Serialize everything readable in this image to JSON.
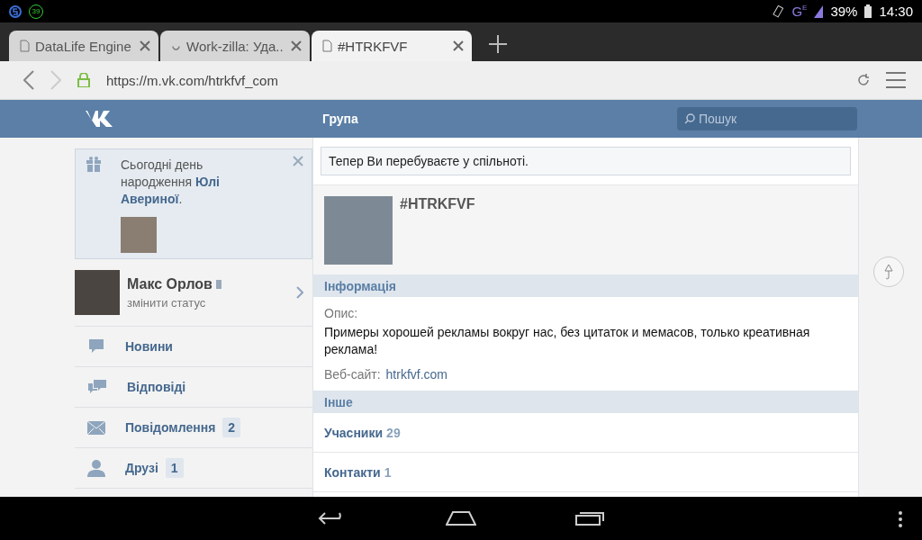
{
  "status_bar": {
    "notification_count": "39",
    "network": "G",
    "network_sub": "E",
    "battery": "39%",
    "time": "14:30"
  },
  "tabs": [
    {
      "title": "DataLife Engine",
      "selected": false,
      "loading": false
    },
    {
      "title": "Work-zilla: Уда...",
      "selected": false,
      "loading": true
    },
    {
      "title": "#HTRKFVF",
      "selected": true,
      "loading": false
    }
  ],
  "address_bar": {
    "url": "https://m.vk.com/htrkfvf_com",
    "secure": true
  },
  "header": {
    "title": "Група",
    "search": {
      "placeholder": "Пошук"
    }
  },
  "birthday": {
    "text": "Сьогодні день народження **Юлі Авериної**."
  },
  "profile": {
    "name": "Макс Орлов",
    "status": "змінити статус"
  },
  "menu": [
    {
      "label": "Новини"
    },
    {
      "label": "Відповіді"
    },
    {
      "label": "Повідомлення",
      "badge": "2"
    },
    {
      "label": "Друзі",
      "badge": "1"
    }
  ],
  "notice": "Тепер Ви перебуваєте у спільноті.",
  "group": {
    "name": "#HTRKFVF"
  },
  "info": {
    "heading": "Інформація",
    "description_label": "Опис:",
    "description": "Примеры хорошей рекламы вокруг нас, без цитаток и мемасов, только креативная реклама!",
    "website_label": "Веб-сайт:",
    "website": "htrkfvf.com"
  },
  "other": {
    "heading": "Інше",
    "rows": [
      {
        "label": "Учасники",
        "count": "29"
      },
      {
        "label": "Контакти",
        "count": "1"
      }
    ]
  }
}
